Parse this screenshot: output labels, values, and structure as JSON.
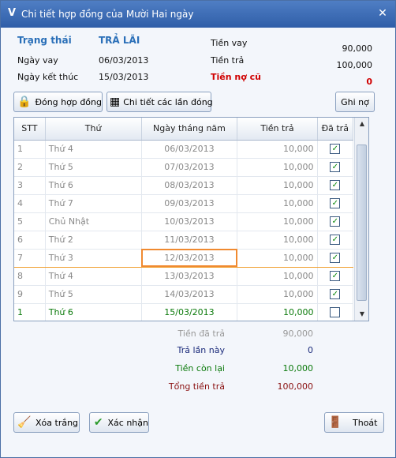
{
  "window": {
    "title": "Chi tiết hợp đồng của Mười Hai ngày",
    "logo": "V",
    "close": "✕"
  },
  "info": {
    "status_label": "Trạng thái",
    "status_value": "TRẢ LÃI",
    "loan_date_label": "Ngày vay",
    "loan_date_value": "06/03/2013",
    "end_date_label": "Ngày kết thúc",
    "end_date_value": "15/03/2013",
    "loan_amount_label": "Tiền vay",
    "loan_amount_value": "90,000",
    "paid_amount_label": "Tiền trả",
    "paid_amount_value": "100,000",
    "old_debt_label": "Tiền nợ cũ",
    "old_debt_value": "0"
  },
  "toolbar": {
    "close_contract_label": "Đóng hợp đồng",
    "payment_details_label": "Chi tiết các lần đóng",
    "record_debt_label": "Ghi nợ"
  },
  "table": {
    "headers": [
      "STT",
      "Thứ",
      "Ngày tháng năm",
      "Tiền trả",
      "Đã trả"
    ],
    "rows": [
      {
        "stt": "1",
        "day": "Thứ 4",
        "date": "06/03/2013",
        "amount": "10,000",
        "paid": "✓"
      },
      {
        "stt": "2",
        "day": "Thứ 5",
        "date": "07/03/2013",
        "amount": "10,000",
        "paid": "✓"
      },
      {
        "stt": "3",
        "day": "Thứ 6",
        "date": "08/03/2013",
        "amount": "10,000",
        "paid": "✓"
      },
      {
        "stt": "4",
        "day": "Thứ 7",
        "date": "09/03/2013",
        "amount": "10,000",
        "paid": "✓"
      },
      {
        "stt": "5",
        "day": "Chủ Nhật",
        "date": "10/03/2013",
        "amount": "10,000",
        "paid": "✓"
      },
      {
        "stt": "6",
        "day": "Thứ 2",
        "date": "11/03/2013",
        "amount": "10,000",
        "paid": "✓"
      },
      {
        "stt": "7",
        "day": "Thứ 3",
        "date": "12/03/2013",
        "amount": "10,000",
        "paid": "✓"
      },
      {
        "stt": "8",
        "day": "Thứ 4",
        "date": "13/03/2013",
        "amount": "10,000",
        "paid": "✓"
      },
      {
        "stt": "9",
        "day": "Thứ 5",
        "date": "14/03/2013",
        "amount": "10,000",
        "paid": "✓"
      },
      {
        "stt": "1",
        "day": "Thứ 6",
        "date": "15/03/2013",
        "amount": "10,000",
        "paid": ""
      }
    ]
  },
  "summary": {
    "total_paid_label": "Tiền đã trả",
    "total_paid_value": "90,000",
    "pay_now_label": "Trả lần này",
    "pay_now_value": "0",
    "remaining_label": "Tiền còn lại",
    "remaining_value": "10,000",
    "grand_total_label": "Tổng tiền trả",
    "grand_total_value": "100,000"
  },
  "footer": {
    "clear_label": "Xóa trắng",
    "confirm_label": "Xác nhận",
    "exit_label": "Thoát"
  },
  "colors": {
    "blue": "#2a6fb8",
    "red": "#d00000",
    "green": "#0b7a0b",
    "navy": "#1a2a7a",
    "maroon": "#8a1010"
  },
  "icons": {
    "scroll_up": "▲",
    "scroll_down": "▼"
  }
}
